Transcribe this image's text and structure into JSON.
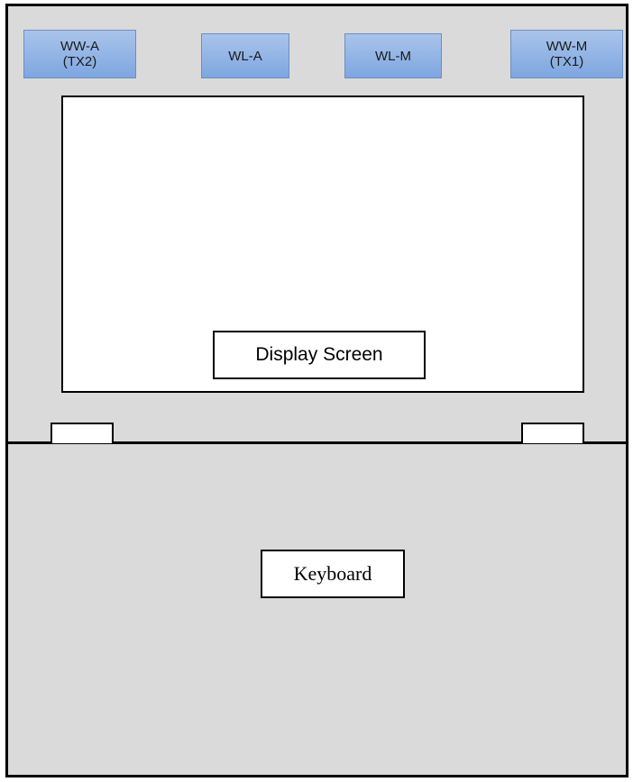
{
  "antennas": [
    {
      "label": "WW-A\n(TX2)"
    },
    {
      "label": "WL-A"
    },
    {
      "label": "WL-M"
    },
    {
      "label": "WW-M\n(TX1)"
    }
  ],
  "screen": {
    "label": "Display Screen"
  },
  "keyboard": {
    "label": "Keyboard"
  },
  "colors": {
    "chassis": "#dadada",
    "outline": "#000000",
    "antenna_fill_top": "#a9c4eb",
    "antenna_fill_bottom": "#7ea6e0",
    "antenna_border": "#6c8ebf",
    "panel": "#ffffff"
  }
}
